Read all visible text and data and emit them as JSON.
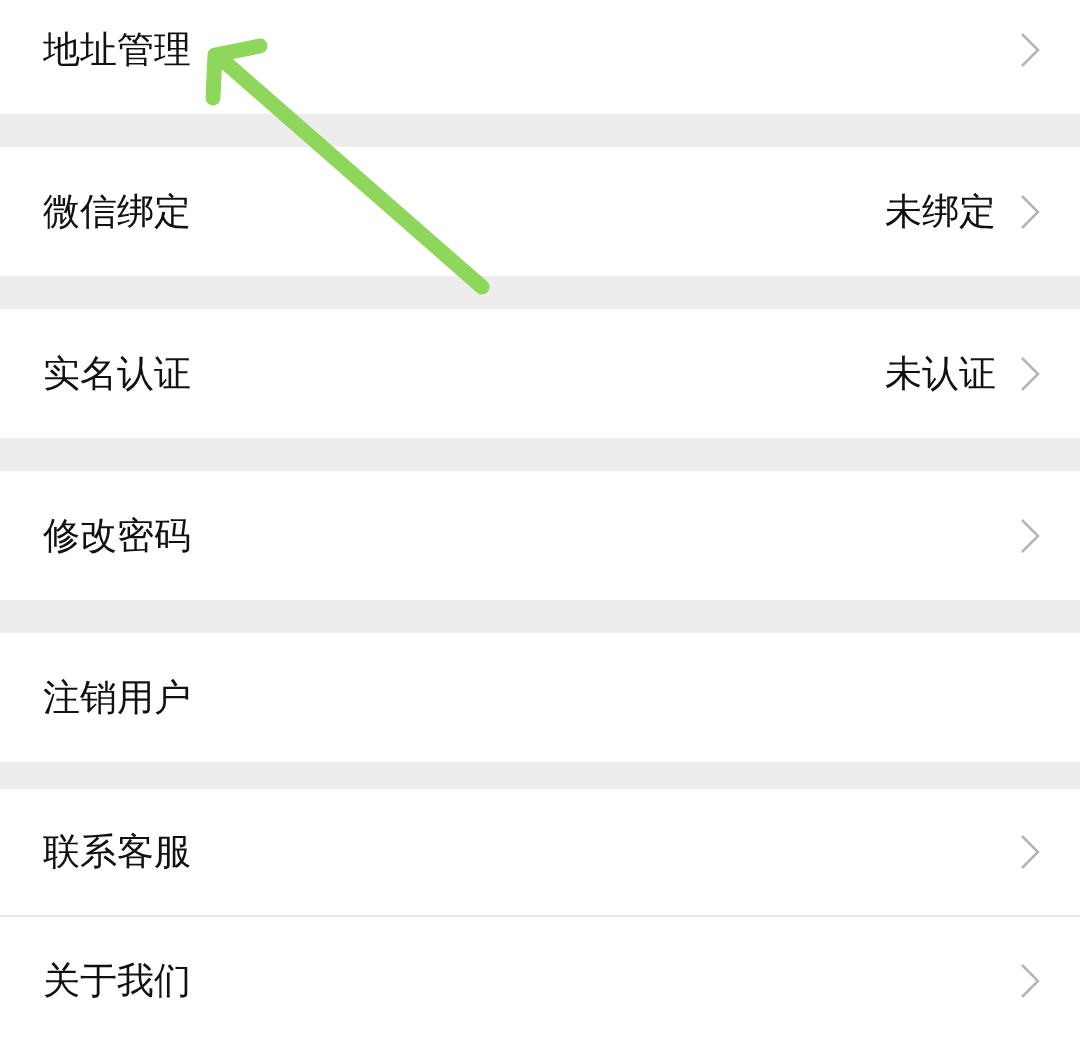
{
  "groups": [
    {
      "items": [
        {
          "label": "地址管理",
          "chevron": true
        }
      ]
    },
    {
      "items": [
        {
          "label": "微信绑定",
          "value": "未绑定",
          "chevron": true
        }
      ]
    },
    {
      "items": [
        {
          "label": "实名认证",
          "value": "未认证",
          "chevron": true
        }
      ]
    },
    {
      "items": [
        {
          "label": "修改密码",
          "chevron": true
        }
      ]
    },
    {
      "items": [
        {
          "label": "注销用户",
          "chevron": false
        }
      ]
    },
    {
      "items": [
        {
          "label": "联系客服",
          "chevron": true
        },
        {
          "label": "关于我们",
          "chevron": true
        }
      ]
    }
  ],
  "annotation": {
    "kind": "arrow"
  }
}
